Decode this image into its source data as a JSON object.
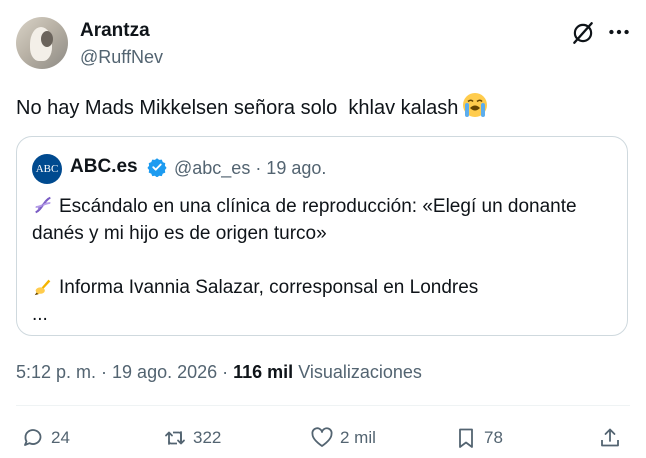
{
  "author": {
    "name": "Arantza",
    "handle": "@RuffNev"
  },
  "tweet": {
    "text": "No hay Mads Mikkelsen señora solo  khlav kalash",
    "emoji": "loudly-crying-face"
  },
  "quote": {
    "logo_text": "ABC",
    "name": "ABC.es",
    "handle_date": "@abc_es · 19 ago.",
    "line1": "Escándalo en una clínica de reproducción: «Elegí un donante",
    "line2": "danés y mi hijo es de origen turco»",
    "line3": "Informa Ivannia Salazar, corresponsal en Londres",
    "line4": "..."
  },
  "meta": {
    "timestamp": "5:12 p. m. · 19 ago. 2026 · ",
    "views_count": "116 mil",
    "views_label": " Visualizaciones"
  },
  "actions": {
    "replies": "24",
    "reposts": "322",
    "likes": "2 mil",
    "bookmarks": "78"
  },
  "colors": {
    "text": "#0f1419",
    "secondary": "#536471",
    "border": "#cfd9de",
    "verified": "#1d9bf0",
    "abc_blue": "#004a8f"
  }
}
